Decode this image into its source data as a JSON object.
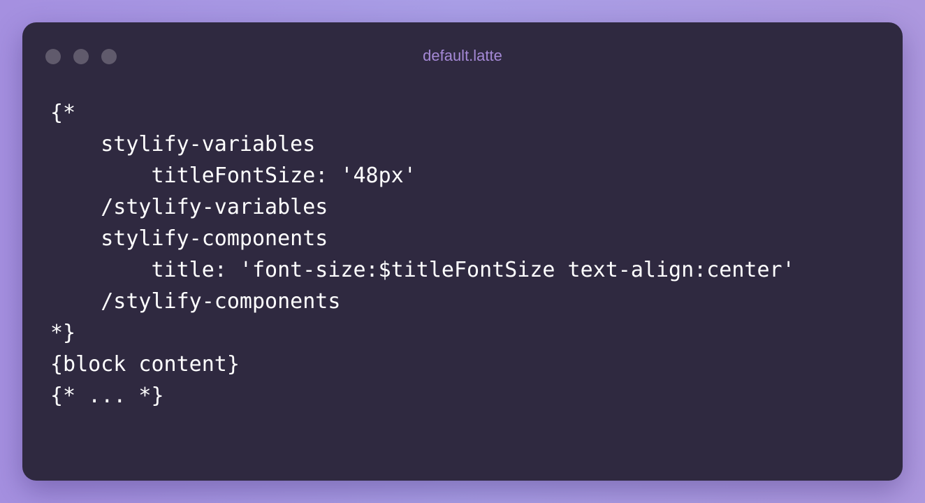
{
  "window": {
    "title": "default.latte",
    "controls": [
      "close-dot",
      "minimize-dot",
      "maximize-dot"
    ]
  },
  "code": {
    "lines": [
      "{*",
      "    stylify-variables",
      "        titleFontSize: '48px'",
      "    /stylify-variables",
      "    stylify-components",
      "        title: 'font-size:$titleFontSize text-align:center'",
      "    /stylify-components",
      "*}",
      "{block content}",
      "{* ... *}"
    ]
  },
  "colors": {
    "background": "#a99ee6",
    "window": "#2f2940",
    "title": "#a589d6",
    "code_text": "#ffffff",
    "window_dots": "#605a6c"
  }
}
